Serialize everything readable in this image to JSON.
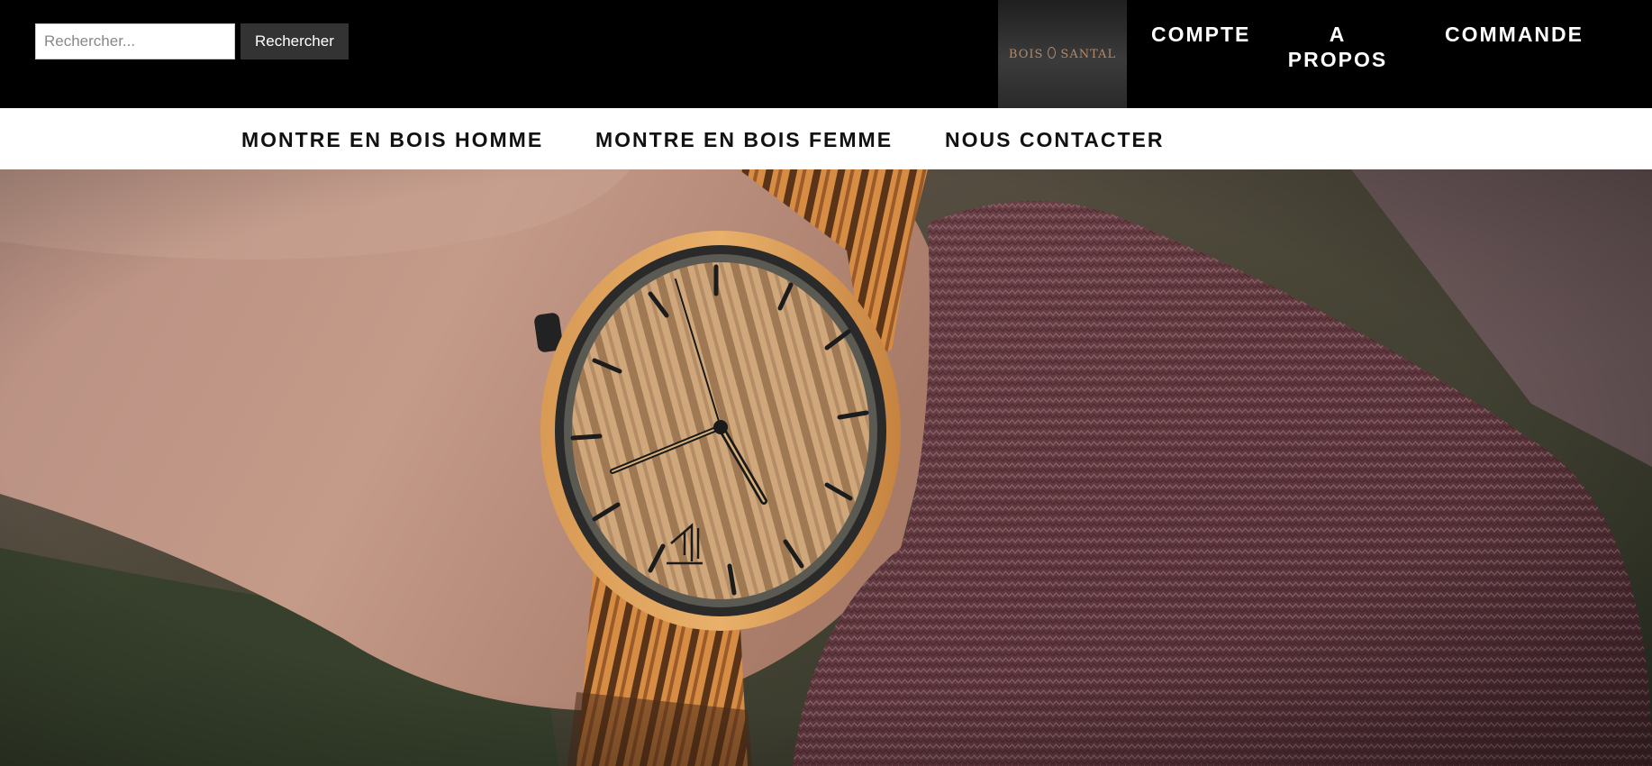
{
  "search": {
    "placeholder": "Rechercher...",
    "value": "",
    "button_label": "Rechercher"
  },
  "brand": {
    "logo_text_left": "BOIS",
    "logo_text_right": "SANTAL"
  },
  "top_nav": {
    "compte": "COMPTE",
    "a_propos_line1": "A",
    "a_propos_line2": "PROPOS",
    "commande": "COMMANDE"
  },
  "main_nav": {
    "homme": "MONTRE EN BOIS HOMME",
    "femme": "MONTRE EN BOIS FEMME",
    "contact": "NOUS CONTACTER"
  },
  "colors": {
    "top_bar": "#000000",
    "nav_bar": "#ffffff",
    "button": "#333333",
    "logo_gold": "#b08a6a"
  },
  "hero": {
    "image": "wooden-wristwatch-photo"
  }
}
